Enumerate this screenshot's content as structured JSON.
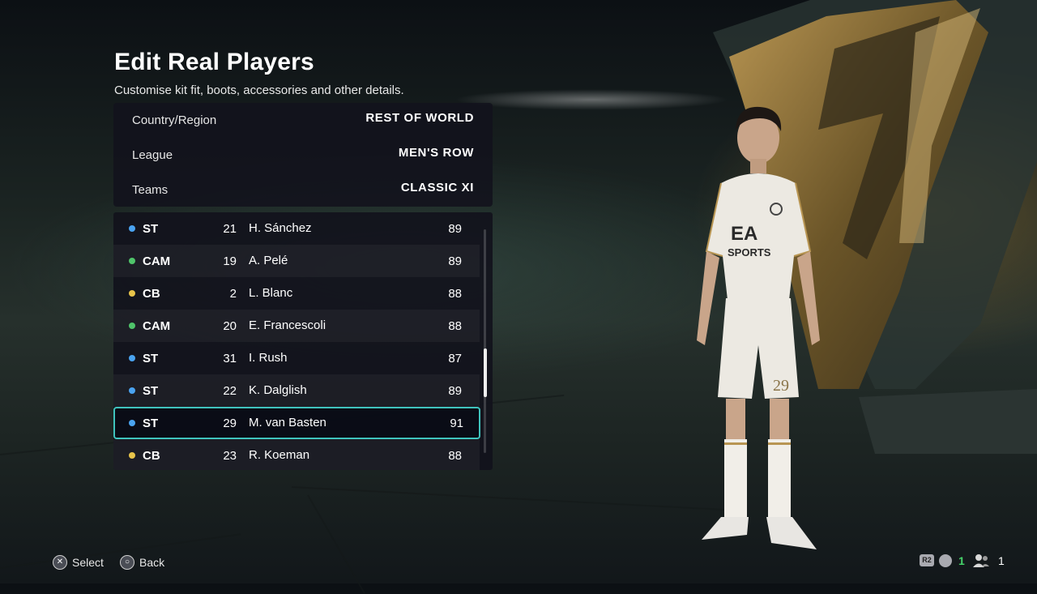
{
  "header": {
    "title": "Edit Real Players",
    "subtitle": "Customise kit fit, boots, accessories and other details."
  },
  "filters": [
    {
      "label": "Country/Region",
      "value": "REST OF WORLD"
    },
    {
      "label": "League",
      "value": "MEN'S ROW"
    },
    {
      "label": "Teams",
      "value": "CLASSIC XI"
    }
  ],
  "position_colors": {
    "ST": "#4aa3f0",
    "CAM": "#4fc46a",
    "CB": "#e8c44a"
  },
  "players": [
    {
      "pos": "ST",
      "number": "21",
      "name": "H. Sánchez",
      "ovr": "89"
    },
    {
      "pos": "CAM",
      "number": "19",
      "name": "A. Pelé",
      "ovr": "89"
    },
    {
      "pos": "CB",
      "number": "2",
      "name": "L. Blanc",
      "ovr": "88"
    },
    {
      "pos": "CAM",
      "number": "20",
      "name": "E. Francescoli",
      "ovr": "88"
    },
    {
      "pos": "ST",
      "number": "31",
      "name": "I. Rush",
      "ovr": "87"
    },
    {
      "pos": "ST",
      "number": "22",
      "name": "K. Dalglish",
      "ovr": "89"
    },
    {
      "pos": "ST",
      "number": "29",
      "name": "M. van Basten",
      "ovr": "91",
      "selected": true
    },
    {
      "pos": "CB",
      "number": "23",
      "name": "R. Koeman",
      "ovr": "88"
    }
  ],
  "kit": {
    "brand_top": "EA",
    "brand_bottom": "SPORTS",
    "shorts_number": "29"
  },
  "footer": {
    "select_label": "Select",
    "back_label": "Back",
    "r2_label": "R2",
    "notifications_count": "1",
    "party_count": "1"
  },
  "icons": {
    "select": "cross-button-icon",
    "back": "circle-button-icon"
  }
}
